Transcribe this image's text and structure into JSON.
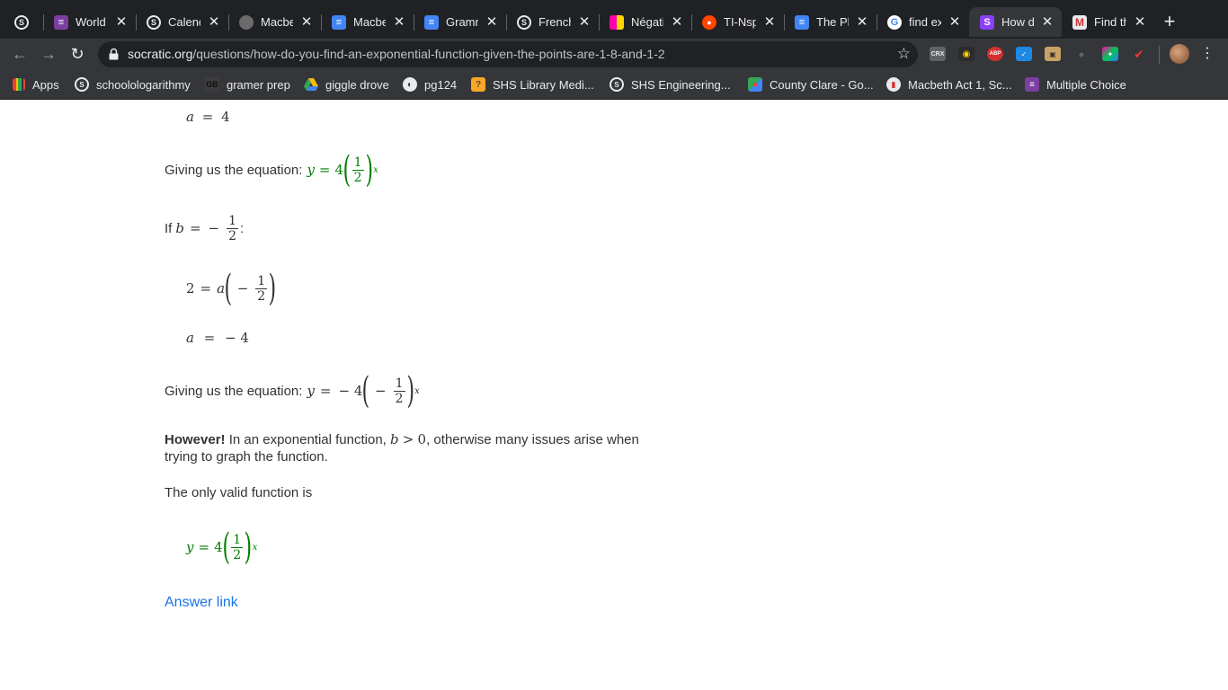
{
  "tabs": [
    {
      "label": "",
      "icon": "socratic-icon"
    },
    {
      "label": "World I",
      "icon": "list-icon"
    },
    {
      "label": "Calend",
      "icon": "socratic-icon"
    },
    {
      "label": "Macbe",
      "icon": "globe-photo-icon"
    },
    {
      "label": "Macbe",
      "icon": "docs-icon"
    },
    {
      "label": "Gramm",
      "icon": "docs-icon"
    },
    {
      "label": "French",
      "icon": "socratic-icon"
    },
    {
      "label": "Négati",
      "icon": "colorgrid-icon"
    },
    {
      "label": "TI-Nsp",
      "icon": "reddit-icon"
    },
    {
      "label": "The Pl",
      "icon": "docs-icon"
    },
    {
      "label": "find ex",
      "icon": "google-icon"
    },
    {
      "label": "How d",
      "icon": "socratic-s-icon",
      "active": true
    },
    {
      "label": "Find th",
      "icon": "m-logo-icon"
    }
  ],
  "toolbar": {
    "url_domain": "socratic.org",
    "url_path": "/questions/how-do-you-find-an-exponential-function-given-the-points-are-1-8-and-1-2",
    "extensions": [
      "CRX",
      "ABP"
    ]
  },
  "bookmarks": [
    {
      "label": "Apps"
    },
    {
      "label": "schoolologarithmy"
    },
    {
      "label": "gramer prep"
    },
    {
      "label": "giggle drove"
    },
    {
      "label": "pg124"
    },
    {
      "label": "SHS Library Medi..."
    },
    {
      "label": "SHS Engineering..."
    },
    {
      "label": "County Clare - Go..."
    },
    {
      "label": "Macbeth Act 1, Sc..."
    },
    {
      "label": "Multiple Choice"
    }
  ],
  "content": {
    "eq_a1": {
      "lhs": "a",
      "op": "=",
      "rhs": "4"
    },
    "giving1_prefix": "Giving us the equation:",
    "eq_y1": {
      "lhs": "y",
      "op": "=",
      "coef": "4",
      "num": "1",
      "den": "2",
      "exp": "x"
    },
    "if_prefix": "If",
    "if_var": "b",
    "if_op": "=",
    "if_neg": "−",
    "if_num": "1",
    "if_den": "2",
    "if_colon": ":",
    "eq_sub": {
      "lhs": "2",
      "op": "=",
      "var": "a",
      "neg": "−",
      "num": "1",
      "den": "2"
    },
    "eq_a2": {
      "lhs": "a",
      "op": "=",
      "rhs": "− 4"
    },
    "giving2_prefix": "Giving us the equation:",
    "eq_y2": {
      "lhs": "y",
      "op": "=",
      "coef": "− 4",
      "neg": "−",
      "num": "1",
      "den": "2",
      "exp": "x"
    },
    "however_bold": "However!",
    "however_text1": "In an exponential function,",
    "however_var": "b",
    "however_op": ">",
    "however_val": "0",
    "however_text2": ", otherwise many issues arise when",
    "however_line2": "trying to graph the function.",
    "only_valid": "The only valid function is",
    "eq_final": {
      "lhs": "y",
      "op": "=",
      "coef": "4",
      "num": "1",
      "den": "2",
      "exp": "x"
    },
    "answer_link": "Answer link"
  },
  "colors": {
    "tabbar_bg": "#202124",
    "toolbar_bg": "#35363a",
    "math_green": "#008000",
    "link_blue": "#1a73e8"
  }
}
